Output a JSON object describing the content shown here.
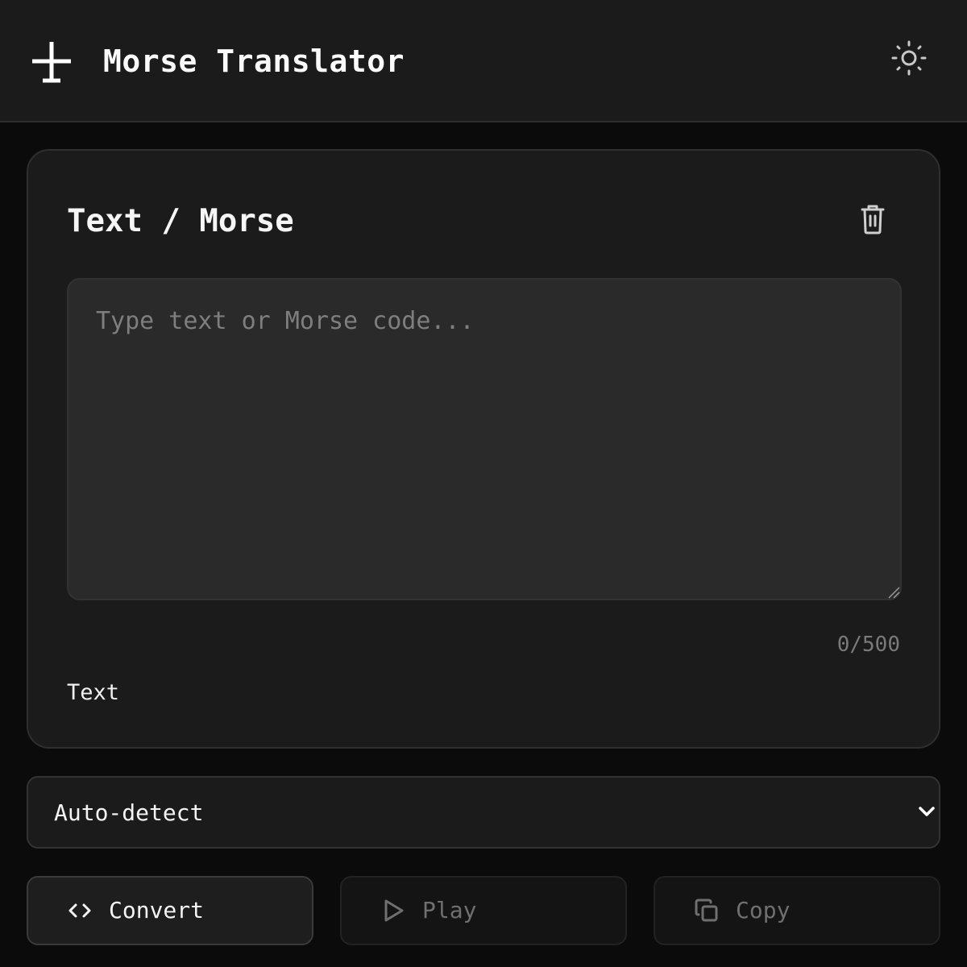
{
  "header": {
    "title": "Morse Translator",
    "logo_icon": "morse-key-icon",
    "theme_icon": "sun-icon"
  },
  "card": {
    "title": "Text / Morse",
    "clear_icon": "trash-icon",
    "input": {
      "value": "",
      "placeholder": "Type text or Morse code..."
    },
    "char_count": "0/500",
    "detected_mode": "Text"
  },
  "mode_select": {
    "selected": "Auto-detect",
    "icon": "chevron-down-icon"
  },
  "actions": {
    "convert": {
      "label": "Convert",
      "icon": "code-brackets-icon"
    },
    "play": {
      "label": "Play",
      "icon": "play-icon"
    },
    "copy": {
      "label": "Copy",
      "icon": "copy-icon"
    }
  },
  "colors": {
    "background": "#0b0b0b",
    "surface": "#1b1b1b",
    "input_bg": "#2a2a2a",
    "text": "#f2f2f2",
    "muted": "#7a7a7a"
  }
}
